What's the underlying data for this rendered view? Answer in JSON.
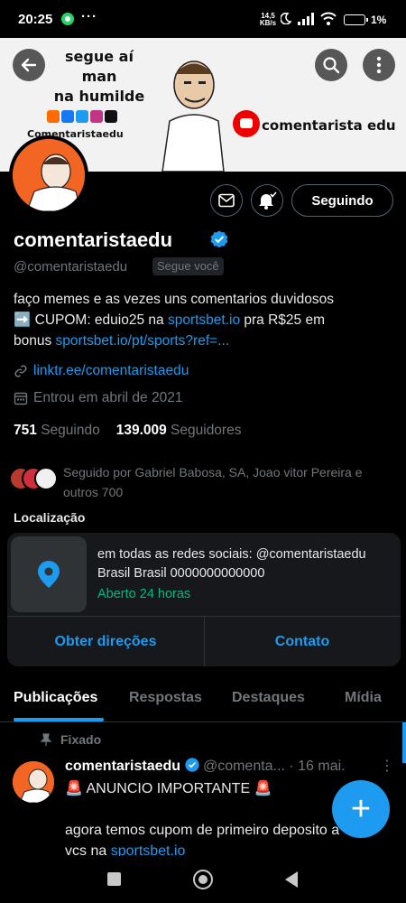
{
  "status_bar": {
    "time": "20:25",
    "dots": "···",
    "speed_top": "14,5",
    "speed_unit": "KB/s",
    "battery": "1%"
  },
  "banner": {
    "text_line1": "segue aí man",
    "text_line2": "na humilde",
    "handle": "Comentaristaedu",
    "youtube_label": "comentarista edu"
  },
  "profile": {
    "display_name": "comentaristaedu",
    "handle": "@comentaristaedu",
    "follows_you": "Segue você",
    "follow_button": "Seguindo",
    "bio_line1": "faço memes e as vezes uns comentarios duvidosos",
    "bio_arrow": "➡️",
    "bio_coupon": " CUPOM: eduio25 na ",
    "bio_link1": "sportsbet.io",
    "bio_after_link": " pra R$25 em",
    "bio_line3_start": "bonus ",
    "bio_link2": "sportsbet.io/pt/sports?ref=...",
    "website": "linktr.ee/comentaristaedu",
    "joined": "Entrou em abril de 2021",
    "following_count": "751",
    "following_label": "Seguindo",
    "followers_count": "139.009",
    "followers_label": "Seguidores",
    "followed_by": "Seguido por Gabriel Babosa, SA, Joao vitor Pereira e outros 700"
  },
  "location": {
    "heading": "Localização",
    "address_line1": "em todas as redes sociais: @comentaristaedu",
    "address_line2": "Brasil Brasil 0000000000000",
    "hours": "Aberto 24 horas",
    "directions_button": "Obter direções",
    "contact_button": "Contato"
  },
  "tabs": [
    "Publicações",
    "Respostas",
    "Destaques",
    "Mídia"
  ],
  "post": {
    "pinned_label": "Fixado",
    "author": "comentaristaedu",
    "handle": "@comenta...",
    "date": "· 16 mai.",
    "line1": "🚨 ANUNCIO IMPORTANTE 🚨",
    "line2": "agora temos cupom de primeiro deposito a",
    "line3_start": "vcs na ",
    "line3_link": "sportsbet.io"
  },
  "fab_label": "+",
  "colors": {
    "accent": "#1d9bf0",
    "background": "#000000",
    "muted_text": "#71767b",
    "open_green": "#00ba7c",
    "avatar_orange": "#f26522"
  }
}
